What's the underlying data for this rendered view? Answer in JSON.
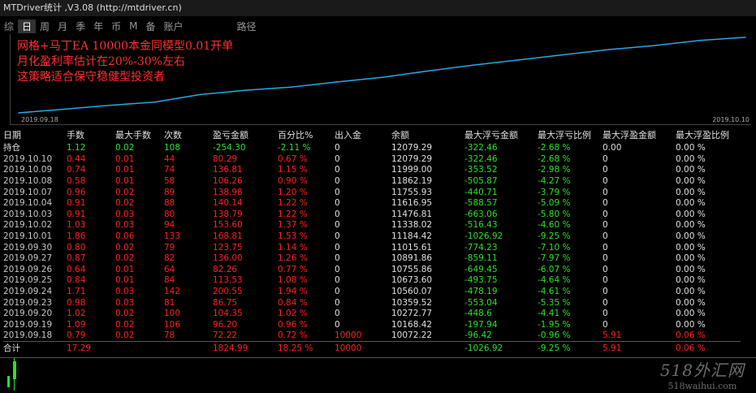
{
  "window": {
    "title": "MTDriver统计 ,V3.08 (http://mtdriver.cn)"
  },
  "toolbar": {
    "items": [
      "综",
      "日",
      "周",
      "月",
      "季",
      "年",
      "币",
      "M",
      "备",
      "账户"
    ],
    "active": "日",
    "route_label": "路径"
  },
  "chart": {
    "overlay_lines": [
      "网格+马丁EA 10000本金同模型0.01开单",
      "月化盈利率估计在20%-30%左右",
      "这策略适合保守稳健型投资者"
    ],
    "start_date": "2019.09.18",
    "end_date": "2019.10.10",
    "line_color": "#2aa8e0"
  },
  "chart_data": {
    "type": "line",
    "title": "",
    "xlabel": "",
    "ylabel": "",
    "x": [
      "2019.09.18",
      "2019.09.19",
      "2019.09.20",
      "2019.09.23",
      "2019.09.24",
      "2019.09.25",
      "2019.09.26",
      "2019.09.27",
      "2019.09.30",
      "2019.10.01",
      "2019.10.02",
      "2019.10.03",
      "2019.10.04",
      "2019.10.07",
      "2019.10.08",
      "2019.10.09",
      "2019.10.10"
    ],
    "values": [
      10072.22,
      10168.42,
      10272.77,
      10359.52,
      10560.07,
      10673.6,
      10755.86,
      10891.86,
      11015.61,
      11184.42,
      11338.02,
      11476.81,
      11616.95,
      11755.93,
      11862.19,
      11999.0,
      12079.29
    ],
    "x_range": [
      "2019.09.18",
      "2019.10.10"
    ],
    "grid": false
  },
  "table": {
    "headers": [
      "日期",
      "手数",
      "最大手数",
      "次数",
      "盈亏金额",
      "百分比%",
      "出入金",
      "余额",
      "最大浮亏金额",
      "最大浮亏比例",
      "最大浮盈金额",
      "最大浮盈比例"
    ],
    "hold": [
      "持仓",
      "1.12",
      "0.02",
      "108",
      "-254.30",
      "-2.11 %",
      "0",
      "12079.29",
      "-322.46",
      "-2.68 %",
      "0.00",
      "0.00 %"
    ],
    "rows": [
      [
        "2019.10.10",
        "0.44",
        "0.01",
        "44",
        "80.29",
        "0.67 %",
        "0",
        "12079.29",
        "-322.46",
        "-2.68 %",
        "0",
        "0.00 %"
      ],
      [
        "2019.10.09",
        "0.74",
        "0.01",
        "74",
        "136.81",
        "1.15 %",
        "0",
        "11999.00",
        "-353.52",
        "-2.98 %",
        "0",
        "0.00 %"
      ],
      [
        "2019.10.08",
        "0.58",
        "0.01",
        "58",
        "106.26",
        "0.90 %",
        "0",
        "11862.19",
        "-505.87",
        "-4.27 %",
        "0",
        "0.00 %"
      ],
      [
        "2019.10.07",
        "0.96",
        "0.02",
        "89",
        "138.98",
        "1.20 %",
        "0",
        "11755.93",
        "-440.71",
        "-3.79 %",
        "0",
        "0.00 %"
      ],
      [
        "2019.10.04",
        "0.91",
        "0.02",
        "88",
        "140.14",
        "1.22 %",
        "0",
        "11616.95",
        "-588.57",
        "-5.09 %",
        "0",
        "0.00 %"
      ],
      [
        "2019.10.03",
        "0.91",
        "0.03",
        "80",
        "138.79",
        "1.22 %",
        "0",
        "11476.81",
        "-663.06",
        "-5.80 %",
        "0",
        "0.00 %"
      ],
      [
        "2019.10.02",
        "1.03",
        "0.03",
        "94",
        "153.60",
        "1.37 %",
        "0",
        "11338.02",
        "-516.43",
        "-4.60 %",
        "0",
        "0.00 %"
      ],
      [
        "2019.10.01",
        "1.86",
        "0.06",
        "133",
        "168.81",
        "1.53 %",
        "0",
        "11184.42",
        "-1026.92",
        "-9.25 %",
        "0",
        "0.00 %"
      ],
      [
        "2019.09.30",
        "0.80",
        "0.02",
        "79",
        "123.75",
        "1.14 %",
        "0",
        "11015.61",
        "-774.23",
        "-7.10 %",
        "0",
        "0.00 %"
      ],
      [
        "2019.09.27",
        "0.87",
        "0.02",
        "82",
        "136.00",
        "1.26 %",
        "0",
        "10891.86",
        "-859.11",
        "-7.97 %",
        "0",
        "0.00 %"
      ],
      [
        "2019.09.26",
        "0.64",
        "0.01",
        "64",
        "82.26",
        "0.77 %",
        "0",
        "10755.86",
        "-649.45",
        "-6.07 %",
        "0",
        "0.00 %"
      ],
      [
        "2019.09.25",
        "0.84",
        "0.01",
        "84",
        "113.53",
        "1.08 %",
        "0",
        "10673.60",
        "-493.75",
        "-4.64 %",
        "0",
        "0.00 %"
      ],
      [
        "2019.09.24",
        "1.71",
        "0.03",
        "142",
        "200.55",
        "1.94 %",
        "0",
        "10560.07",
        "-478.19",
        "-4.61 %",
        "0",
        "0.00 %"
      ],
      [
        "2019.09.23",
        "0.98",
        "0.03",
        "81",
        "86.75",
        "0.84 %",
        "0",
        "10359.52",
        "-553.04",
        "-5.35 %",
        "0",
        "0.00 %"
      ],
      [
        "2019.09.20",
        "1.02",
        "0.02",
        "100",
        "104.35",
        "1.02 %",
        "0",
        "10272.77",
        "-448.6",
        "-4.41 %",
        "0",
        "0.00 %"
      ],
      [
        "2019.09.19",
        "1.09",
        "0.02",
        "106",
        "96.20",
        "0.96 %",
        "0",
        "10168.42",
        "-197.94",
        "-1.95 %",
        "0",
        "0.00 %"
      ],
      [
        "2019.09.18",
        "0.79",
        "0.02",
        "78",
        "72.22",
        "0.72 %",
        "10000",
        "10072.22",
        "-96.42",
        "-0.96 %",
        "5.91",
        "0.06 %"
      ]
    ],
    "total": [
      "合计",
      "17.29",
      "",
      "",
      "1824.99",
      "18.25 %",
      "10000",
      "",
      "-1026.92",
      "-9.25 %",
      "5.91",
      "0.06 %"
    ]
  },
  "watermark": {
    "line1": "518外汇网",
    "line2": "518waihui.com"
  },
  "colors": {
    "positive": "#ff2020",
    "negative": "#29e129",
    "text": "#c8c8c8",
    "background": "#000000"
  }
}
